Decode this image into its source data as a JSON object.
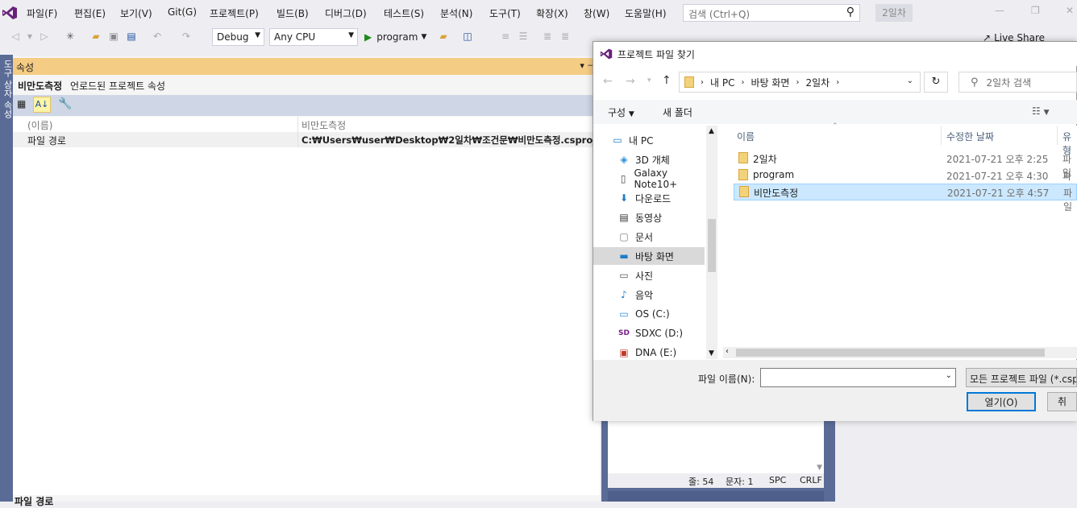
{
  "menu": {
    "items": [
      "파일(F)",
      "편집(E)",
      "보기(V)",
      "Git(G)",
      "프로젝트(P)",
      "빌드(B)",
      "디버그(D)",
      "테스트(S)",
      "분석(N)",
      "도구(T)",
      "확장(X)",
      "창(W)",
      "도움말(H)"
    ],
    "search_placeholder": "검색 (Ctrl+Q)",
    "solution_name": "2일차"
  },
  "toolbar": {
    "config": "Debug",
    "platform": "Any CPU",
    "run_label": "program",
    "live_share": "Live Share"
  },
  "side_strip_label": "도구 상자  속성",
  "properties": {
    "title": "속성",
    "subject": "비만도측정",
    "subject_desc": "언로드된 프로젝트 속성",
    "rows": [
      {
        "name": "(이름)",
        "value": "비만도측정"
      },
      {
        "name": "파일 경로",
        "value": "C:₩Users₩user₩Desktop₩2일차₩조건문₩비만도측정.csproj"
      }
    ],
    "desc_label": "파일 경로"
  },
  "editor_status": {
    "line": "줄: 54",
    "col": "문자: 1",
    "mode": "SPC",
    "eol": "CRLF"
  },
  "dialog": {
    "title": "프로젝트 파일 찾기",
    "breadcrumb": [
      "내 PC",
      "바탕 화면",
      "2일차"
    ],
    "search_placeholder": "2일차 검색",
    "organize": "구성",
    "new_folder": "새 폴더",
    "nav": [
      {
        "label": "내 PC",
        "icon": "pc-icon"
      },
      {
        "label": "3D 개체",
        "icon": "cube-icon"
      },
      {
        "label": "Galaxy Note10+",
        "icon": "phone-icon"
      },
      {
        "label": "다운로드",
        "icon": "download-icon"
      },
      {
        "label": "동영상",
        "icon": "film-icon"
      },
      {
        "label": "문서",
        "icon": "document-icon"
      },
      {
        "label": "바탕 화면",
        "icon": "desktop-icon"
      },
      {
        "label": "사진",
        "icon": "picture-icon"
      },
      {
        "label": "음악",
        "icon": "music-icon"
      },
      {
        "label": "OS (C:)",
        "icon": "drive-icon"
      },
      {
        "label": "SDXC (D:)",
        "icon": "sd-card-icon"
      },
      {
        "label": "DNA (E:)",
        "icon": "usb-drive-icon"
      }
    ],
    "columns": {
      "name": "이름",
      "modified": "수정한 날짜",
      "type": "유형"
    },
    "files": [
      {
        "name": "2일차",
        "modified": "2021-07-21 오후 2:25",
        "type": "파일"
      },
      {
        "name": "program",
        "modified": "2021-07-21 오후 4:30",
        "type": "파일"
      },
      {
        "name": "비만도측정",
        "modified": "2021-07-21 오후 4:57",
        "type": "파일"
      }
    ],
    "filename_label": "파일 이름(N):",
    "filename_value": "",
    "filter": "모든 프로젝트 파일 (*.csp",
    "open_button": "열기(O)",
    "cancel_button": "취"
  },
  "colors": {
    "accent": "#007acc",
    "props_title_bg": "#f5cc84",
    "selected_row": "#cce8ff",
    "side_strip": "#5a6b96"
  }
}
